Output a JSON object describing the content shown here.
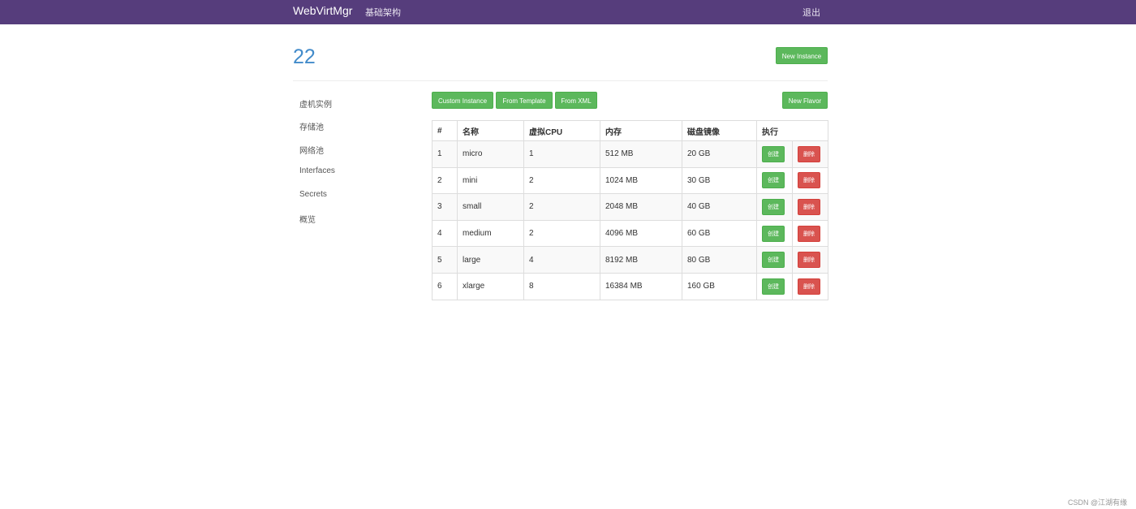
{
  "navbar": {
    "brand": "WebVirtMgr",
    "infra": "基础架构",
    "logout": "退出"
  },
  "header": {
    "title": "22",
    "new_instance": "New Instance"
  },
  "sidebar": {
    "items": [
      "虚机实例",
      "存储池",
      "网络池",
      "Interfaces",
      "Secrets",
      "概览"
    ]
  },
  "toolbar": {
    "custom_instance": "Custom Instance",
    "from_template": "From Template",
    "from_xml": "From XML",
    "new_flavor": "New Flavor"
  },
  "table": {
    "headers": [
      "#",
      "名称",
      "虚拟CPU",
      "内存",
      "磁盘镜像",
      "执行"
    ],
    "create_label": "创建",
    "delete_label": "删除",
    "rows": [
      [
        "1",
        "micro",
        "1",
        "512 MB",
        "20 GB"
      ],
      [
        "2",
        "mini",
        "2",
        "1024 MB",
        "30 GB"
      ],
      [
        "3",
        "small",
        "2",
        "2048 MB",
        "40 GB"
      ],
      [
        "4",
        "medium",
        "2",
        "4096 MB",
        "60 GB"
      ],
      [
        "5",
        "large",
        "4",
        "8192 MB",
        "80 GB"
      ],
      [
        "6",
        "xlarge",
        "8",
        "16384 MB",
        "160 GB"
      ]
    ]
  },
  "footer": {
    "watermark": "CSDN @江湖有缘"
  },
  "colors": {
    "navbar": "#563d7c",
    "success": "#5cb85c",
    "danger": "#d9534f",
    "title": "#428bca"
  }
}
